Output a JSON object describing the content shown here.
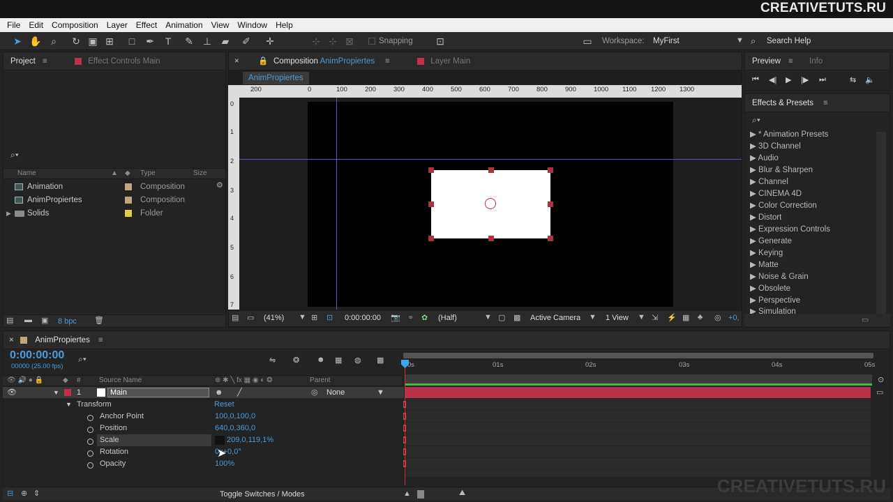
{
  "brand": "CREATIVETUTS.RU",
  "watermark": "CREATIVETUTS.RU",
  "menu": [
    "File",
    "Edit",
    "Composition",
    "Layer",
    "Effect",
    "Animation",
    "View",
    "Window",
    "Help"
  ],
  "toolbar": {
    "snapping": "Snapping",
    "workspace_label": "Workspace:",
    "workspace_value": "MyFirst",
    "search_placeholder": "Search Help"
  },
  "project": {
    "tab": "Project",
    "effect_controls_tab": "Effect Controls Main",
    "cols": {
      "name": "Name",
      "type": "Type",
      "size": "Size"
    },
    "items": [
      {
        "name": "Animation",
        "type": "Composition",
        "color": "#c4a67a"
      },
      {
        "name": "AnimPropiertes",
        "type": "Composition",
        "color": "#c4a67a"
      },
      {
        "name": "Solids",
        "type": "Folder",
        "color": "#e0d040"
      }
    ],
    "bpc": "8 bpc"
  },
  "composition": {
    "tab_prefix": "Composition",
    "tab_name": "AnimPropiertes",
    "layer_tab": "Layer Main",
    "crumb": "AnimPropiertes",
    "ruler_h": [
      "200",
      "0",
      "100",
      "200",
      "300",
      "400",
      "500",
      "600",
      "700",
      "800",
      "900",
      "1000",
      "1100",
      "1200",
      "1300"
    ],
    "ruler_v": [
      "0",
      "1",
      "2",
      "3",
      "4",
      "5",
      "6",
      "7"
    ],
    "zoom": "(41%)",
    "timecode": "0:00:00:00",
    "resolution": "(Half)",
    "camera": "Active Camera",
    "views": "1 View",
    "exposure": "+0,"
  },
  "preview": {
    "tab": "Preview",
    "info_tab": "Info"
  },
  "effects": {
    "title": "Effects & Presets",
    "items": [
      "* Animation Presets",
      "3D Channel",
      "Audio",
      "Blur & Sharpen",
      "Channel",
      "CINEMA 4D",
      "Color Correction",
      "Distort",
      "Expression Controls",
      "Generate",
      "Keying",
      "Matte",
      "Noise & Grain",
      "Obsolete",
      "Perspective",
      "Simulation"
    ]
  },
  "timeline": {
    "tab": "AnimPropiertes",
    "timecode": "0:00:00:00",
    "fps": "00000 (25.00 fps)",
    "col_source": "Source Name",
    "col_parent": "Parent",
    "layer": {
      "num": "1",
      "name": "Main",
      "parent": "None",
      "color": "#c0304a"
    },
    "transform": "Transform",
    "reset": "Reset",
    "props": [
      {
        "name": "Anchor Point",
        "value": "100,0,100,0"
      },
      {
        "name": "Position",
        "value": "640,0,360,0"
      },
      {
        "name": "Scale",
        "value": "209,0,119,1%"
      },
      {
        "name": "Rotation",
        "value": "0x+0,0°"
      },
      {
        "name": "Opacity",
        "value": "100%"
      }
    ],
    "ruler": [
      "0s",
      "01s",
      "02s",
      "03s",
      "04s",
      "05s"
    ],
    "toggle": "Toggle Switches / Modes"
  }
}
